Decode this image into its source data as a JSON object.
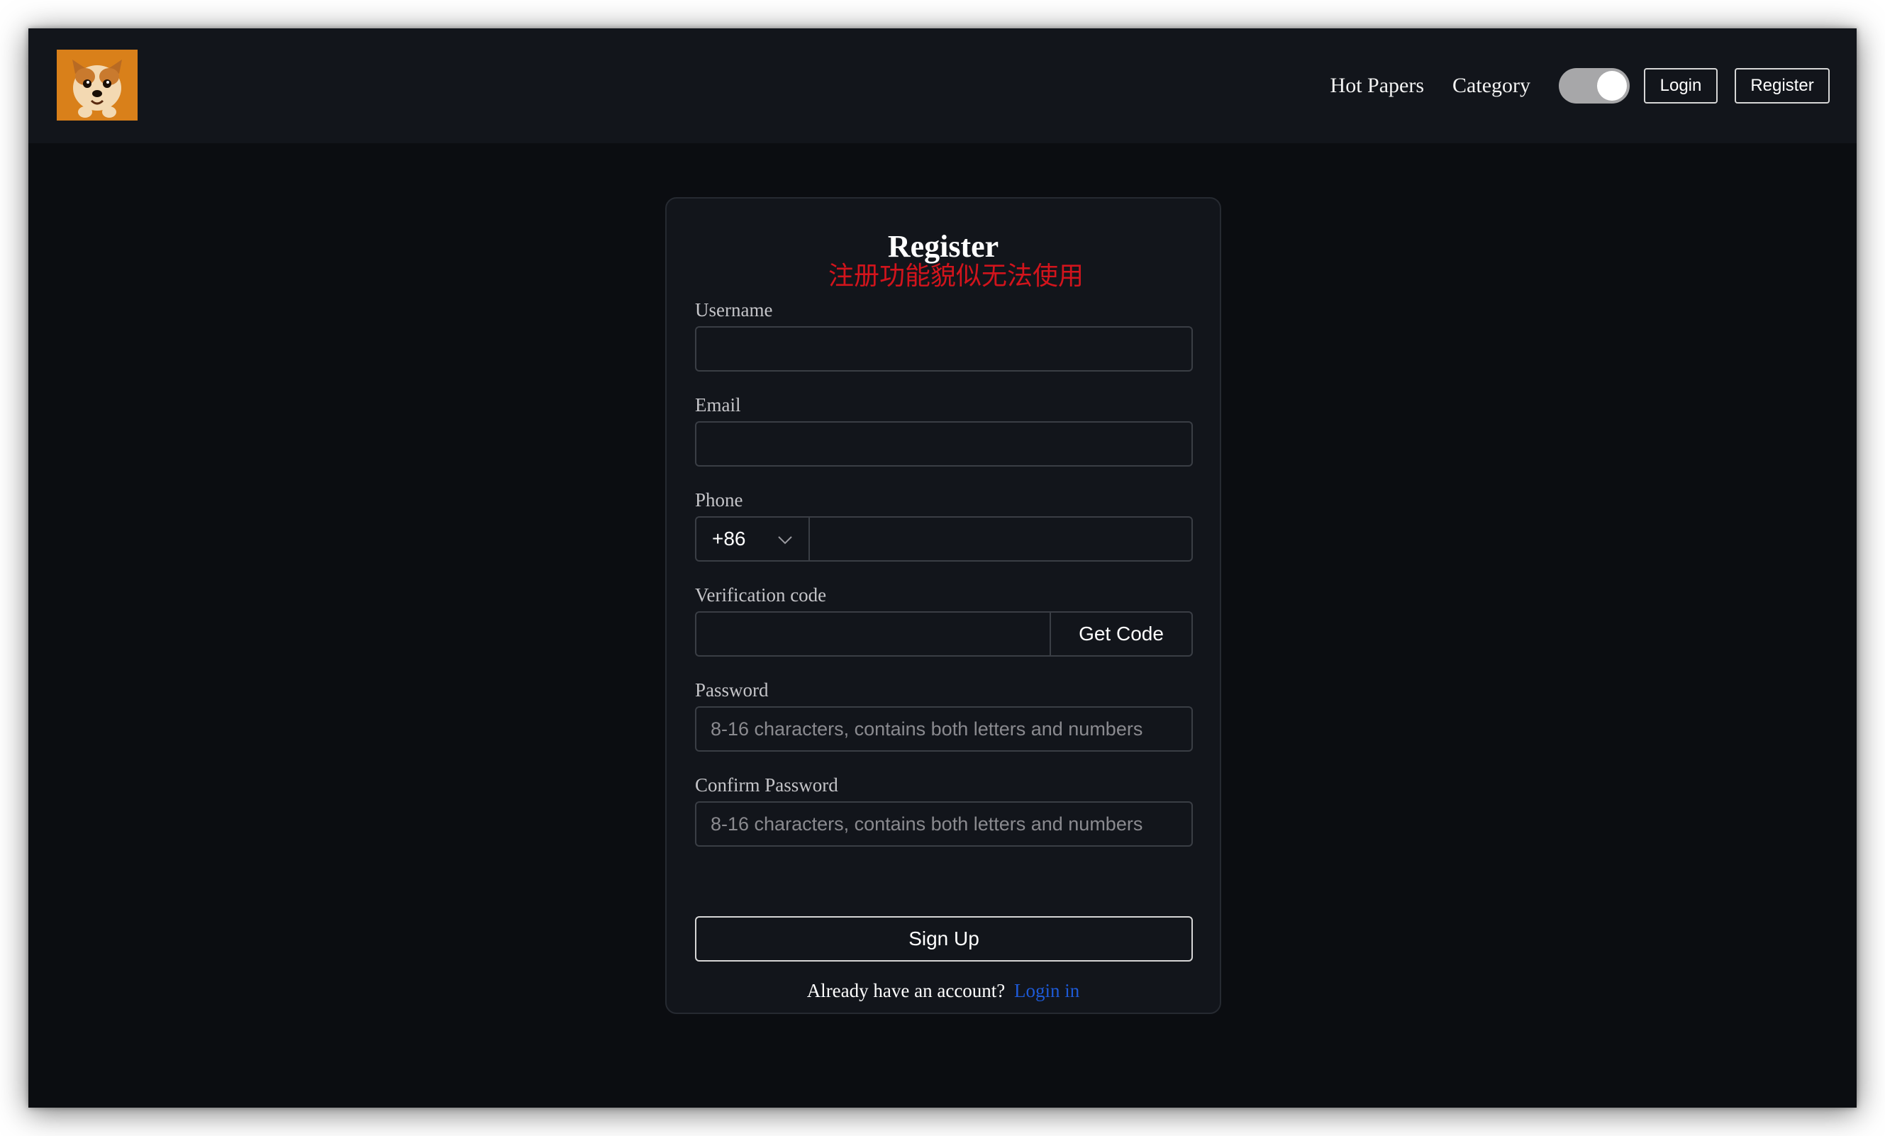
{
  "header": {
    "logo_icon": "dog-avatar-icon",
    "nav": {
      "hot_papers": "Hot Papers",
      "category": "Category"
    },
    "theme_toggle": {
      "state": "on"
    },
    "login_label": "Login",
    "register_label": "Register"
  },
  "form": {
    "title": "Register",
    "note": "注册功能貌似无法使用",
    "username": {
      "label": "Username",
      "value": "",
      "placeholder": ""
    },
    "email": {
      "label": "Email",
      "value": "",
      "placeholder": ""
    },
    "phone": {
      "label": "Phone",
      "country_code": "+86",
      "value": ""
    },
    "verification": {
      "label": "Verification code",
      "value": "",
      "button": "Get Code"
    },
    "password": {
      "label": "Password",
      "placeholder": "8-16 characters, contains both letters and numbers"
    },
    "confirm_password": {
      "label": "Confirm Password",
      "placeholder": "8-16 characters, contains both letters and numbers"
    },
    "submit_label": "Sign Up",
    "footer": {
      "text": "Already have an account?",
      "link": "Login in"
    }
  },
  "colors": {
    "background": "#0b0d11",
    "card": "#12151b",
    "note_red": "#d2141c",
    "link_blue": "#1e5ad6"
  }
}
